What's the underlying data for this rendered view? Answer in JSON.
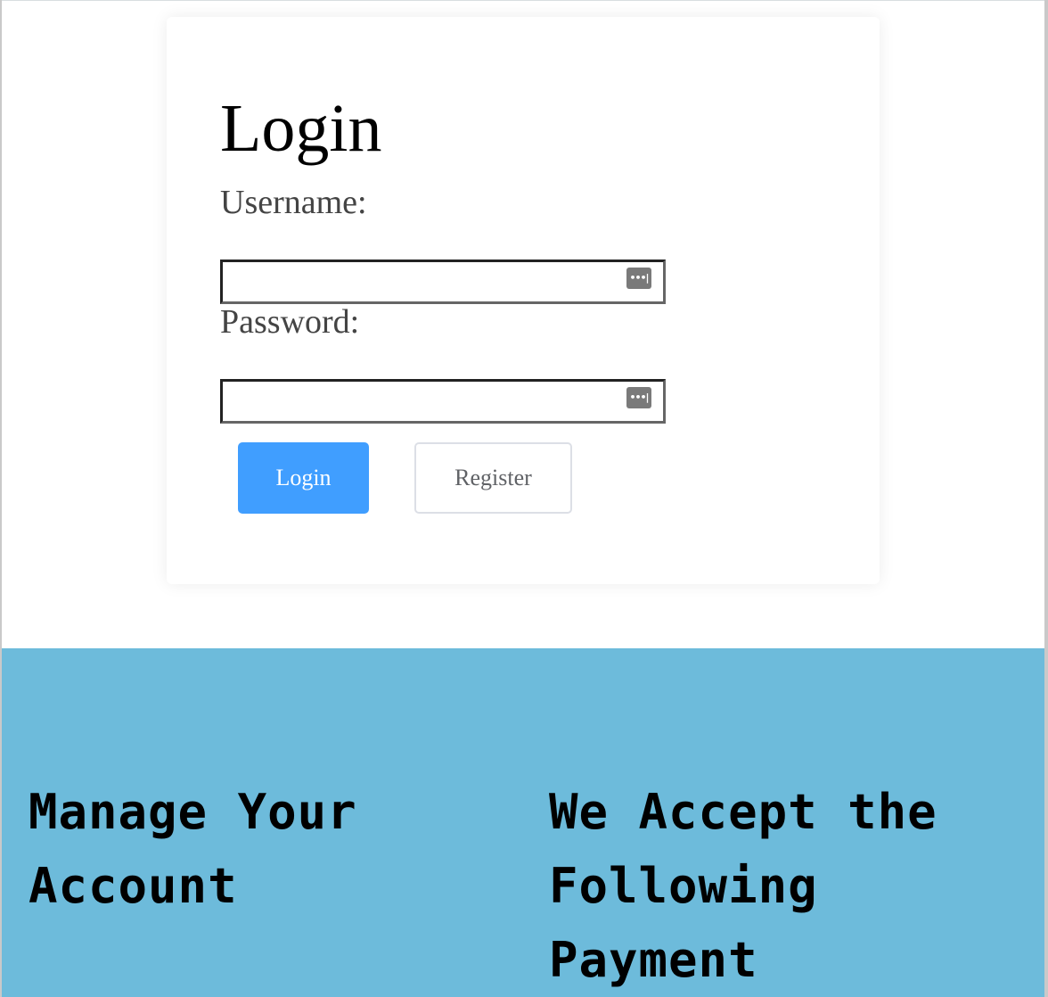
{
  "login_card": {
    "title": "Login",
    "username_label": "Username:",
    "username_value": "",
    "password_label": "Password:",
    "password_value": "",
    "password_manager_icon": "password-manager-icon",
    "login_button": "Login",
    "register_button": "Register"
  },
  "footer": {
    "manage_heading": "Manage Your Account",
    "payment_heading": "We Accept the Following Payment"
  },
  "colors": {
    "primary_button": "#409eff",
    "footer_background": "#6dbbdb"
  }
}
